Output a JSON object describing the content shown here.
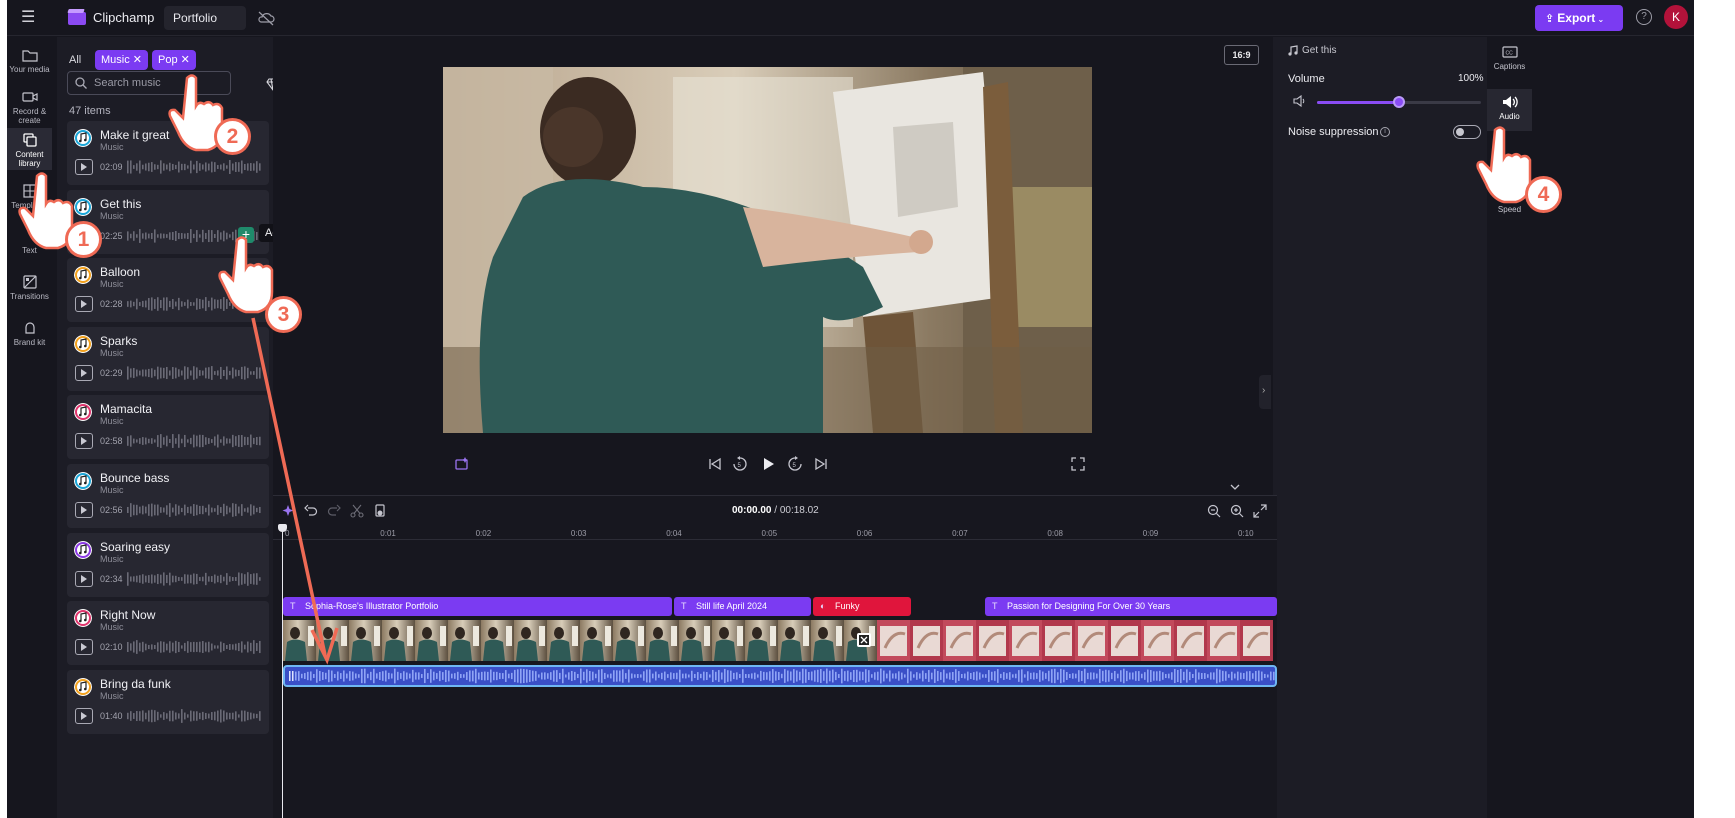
{
  "topbar": {
    "app_name": "Clipchamp",
    "project_name": "Portfolio",
    "export_label": "Export",
    "help_label": "?",
    "avatar_initial": "K"
  },
  "left_nav": {
    "items": [
      {
        "label": "Your media",
        "icon": "folder-icon"
      },
      {
        "label": "Record & create",
        "icon": "camera-icon"
      },
      {
        "label": "Content library",
        "icon": "content-library-icon",
        "active": true
      },
      {
        "label": "Templates",
        "icon": "templates-icon"
      },
      {
        "label": "Text",
        "icon": "text-icon"
      },
      {
        "label": "Transitions",
        "icon": "transitions-icon"
      },
      {
        "label": "Brand kit",
        "icon": "brand-kit-icon"
      }
    ]
  },
  "library": {
    "filter_all": "All",
    "filter_chips": [
      "Music",
      "Pop"
    ],
    "search_placeholder": "Search music",
    "count": "47 items",
    "add_tooltip": "Add to timeline",
    "tracks": [
      {
        "title": "Make it great",
        "type": "Music",
        "duration": "02:09",
        "color": "#1ba6d8"
      },
      {
        "title": "Get this",
        "type": "Music",
        "duration": "02:25",
        "color": "#1ba6d8"
      },
      {
        "title": "Balloon",
        "type": "Music",
        "duration": "02:28",
        "color": "#f2a11e"
      },
      {
        "title": "Sparks",
        "type": "Music",
        "duration": "02:29",
        "color": "#f2a11e"
      },
      {
        "title": "Mamacita",
        "type": "Music",
        "duration": "02:58",
        "color": "#e0346d"
      },
      {
        "title": "Bounce bass",
        "type": "Music",
        "duration": "02:56",
        "color": "#1ba6d8"
      },
      {
        "title": "Soaring easy",
        "type": "Music",
        "duration": "02:34",
        "color": "#8d3ae6"
      },
      {
        "title": "Right Now",
        "type": "Music",
        "duration": "02:10",
        "color": "#e0346d"
      },
      {
        "title": "Bring da funk",
        "type": "Music",
        "duration": "01:40",
        "color": "#f2a11e"
      }
    ]
  },
  "preview": {
    "aspect_ratio": "16:9"
  },
  "audio_panel": {
    "track_name": "Get this",
    "volume_label": "Volume",
    "volume_value": "100%",
    "volume_fraction": 0.5,
    "noise_label": "Noise suppression",
    "noise_on": false
  },
  "right_nav": {
    "items": [
      {
        "label": "Captions",
        "icon": "captions-icon"
      },
      {
        "label": "Audio",
        "icon": "audio-icon",
        "active": true
      },
      {
        "label": "Speed",
        "icon": "speed-icon"
      }
    ]
  },
  "timeline": {
    "current_time": "00:00.00",
    "total_time": "/ 00:18.02",
    "ruler": [
      "0",
      "0:01",
      "0:02",
      "0:03",
      "0:04",
      "0:05",
      "0:06",
      "0:07",
      "0:08",
      "0:09",
      "0:10"
    ],
    "text_clips": [
      {
        "label": "Sophia-Rose's Illustrator Portfolio"
      },
      {
        "label": "Still life April 2024"
      },
      {
        "label": "Funky"
      },
      {
        "label": "Passion for Designing For Over 30 Years"
      }
    ]
  },
  "annotations": {
    "steps": [
      "1",
      "2",
      "3",
      "4"
    ],
    "accent_color": "#ef6a55"
  },
  "colors": {
    "accent": "#7b3bf2",
    "background": "#16161e",
    "panel": "#1c1c25",
    "audio_clip": "#3a4fc7",
    "funky_clip": "#e0153c"
  }
}
